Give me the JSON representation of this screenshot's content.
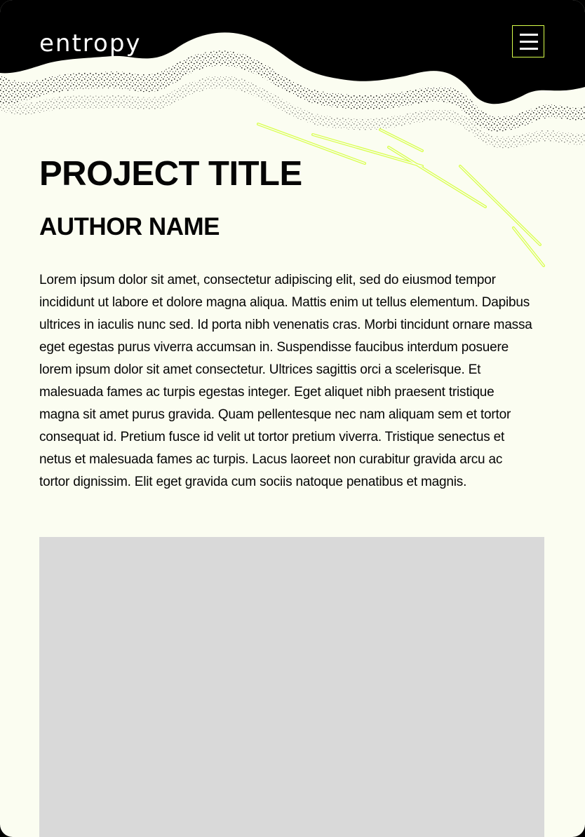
{
  "header": {
    "logo_text": "entropy",
    "menu_icon": "hamburger-menu-icon",
    "accent_color": "#d8ff4a"
  },
  "main": {
    "title": "PROJECT TITLE",
    "author": "AUTHOR NAME",
    "description": "Lorem ipsum dolor sit amet, consectetur adipiscing elit, sed do eiusmod tempor incididunt ut labore et dolore magna aliqua. Mattis enim ut tellus elementum. Dapibus ultrices in iaculis nunc sed. Id porta nibh venenatis cras. Morbi tincidunt ornare massa eget egestas purus viverra accumsan in. Suspendisse faucibus interdum posuere lorem ipsum dolor sit amet consectetur. Ultrices sagittis orci a scelerisque. Et malesuada fames ac turpis egestas integer. Eget aliquet nibh praesent tristique magna sit amet purus gravida. Quam pellentesque nec nam aliquam sem et tortor consequat id. Pretium fusce id velit ut tortor pretium viverra. Tristique senectus et netus et malesuada fames ac turpis. Lacus laoreet non curabitur gravida arcu ac tortor dignissim. Elit eget gravida cum sociis natoque penatibus et magnis."
  },
  "colors": {
    "background": "#fbfdf1",
    "header": "#000000",
    "placeholder": "#d9d9d9"
  }
}
